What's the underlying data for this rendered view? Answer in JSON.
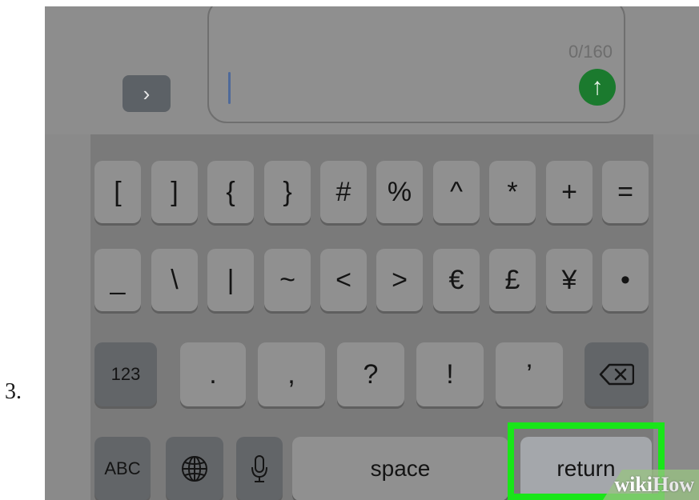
{
  "step": {
    "number": "3."
  },
  "compose": {
    "expand_icon": "chevron-right-icon",
    "char_count": "0/160",
    "send_icon": "arrow-up-icon"
  },
  "keyboard": {
    "row1": [
      "[",
      "]",
      "{",
      "}",
      "#",
      "%",
      "^",
      "*",
      "+",
      "="
    ],
    "row2": [
      "_",
      "\\",
      "|",
      "~",
      "<",
      ">",
      "€",
      "£",
      "¥",
      "•"
    ],
    "row3": {
      "mode": "123",
      "keys": [
        ".",
        ",",
        "?",
        "!",
        "’"
      ],
      "delete_icon": "backspace-icon"
    },
    "row4": {
      "mode": "ABC",
      "globe_icon": "globe-icon",
      "mic_icon": "microphone-icon",
      "space": "space",
      "return": "return"
    }
  },
  "highlight_color": "#19e619",
  "watermark": {
    "wiki": "wiki",
    "how": "How"
  }
}
